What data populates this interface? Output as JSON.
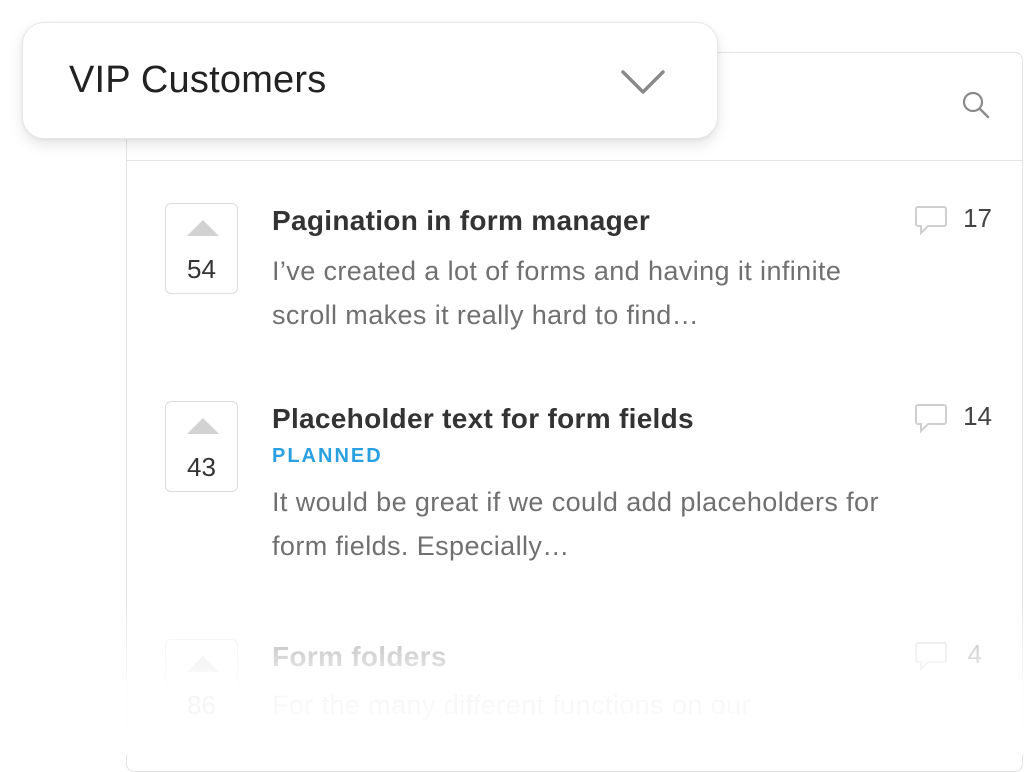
{
  "filter": {
    "selected": "VIP Customers"
  },
  "posts": [
    {
      "votes": "54",
      "title": "Pagination in form manager",
      "status": "",
      "description": "I’ve created a lot of forms and having it infinite scroll makes it really hard to find…",
      "comments": "17"
    },
    {
      "votes": "43",
      "title": "Placeholder text for form fields",
      "status": "PLANNED",
      "description": "It would be great if we could add placeholders for form fields. Especially…",
      "comments": "14"
    },
    {
      "votes": "86",
      "title": "Form folders",
      "status": "",
      "description": "For the many different functions on our",
      "comments": "4"
    }
  ],
  "colors": {
    "status_planned": "#2aa0e0",
    "accent_text": "#333333",
    "muted_text": "#707070"
  },
  "icons": [
    "search-icon",
    "chevron-down-icon",
    "upvote-arrow-icon",
    "comment-icon"
  ]
}
